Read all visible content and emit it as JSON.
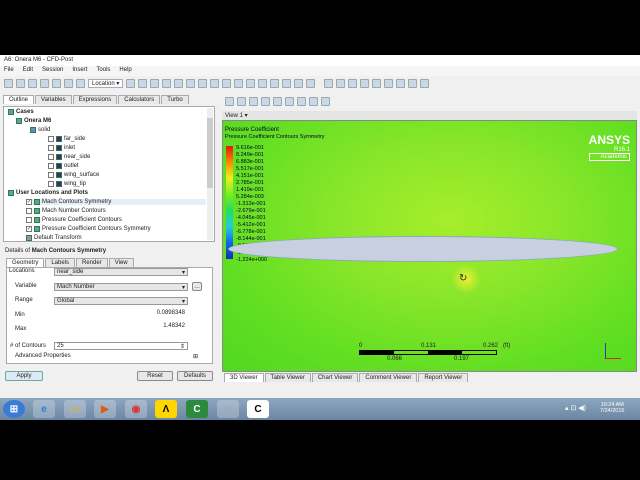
{
  "window": {
    "title": "A6: Onera M6 - CFD-Post"
  },
  "menu": [
    "File",
    "Edit",
    "Session",
    "Insert",
    "Tools",
    "Help"
  ],
  "toolbar": {
    "location_label": "Location"
  },
  "left_tabs": [
    "Outline",
    "Variables",
    "Expressions",
    "Calculators",
    "Turbo"
  ],
  "tree": {
    "cases": "Cases",
    "case": "Onera M6",
    "domain": "solid",
    "boundaries": [
      "far_side",
      "inlet",
      "near_side",
      "outlet",
      "wing_surface",
      "wing_tip"
    ],
    "user_locations": "User Locations and Plots",
    "plots": [
      {
        "label": "Mach Contours Symmetry",
        "checked": true
      },
      {
        "label": "Mach Number Contours",
        "checked": false
      },
      {
        "label": "Pressure Coefficient Contours",
        "checked": false
      },
      {
        "label": "Pressure Coefficient Contours Symmetry",
        "checked": true
      }
    ],
    "default_transform": "Default Transform"
  },
  "details": {
    "prefix": "Details of",
    "object": "Mach Contours Symmetry",
    "tabs": [
      "Geometry",
      "Labels",
      "Render",
      "View"
    ],
    "locations_label": "Locations",
    "locations_value": "near_side",
    "variable_label": "Variable",
    "variable_value": "Mach Number",
    "range_label": "Range",
    "range_value": "Global",
    "min_label": "Min",
    "min_value": "0.0898348",
    "max_label": "Max",
    "max_value": "1.48342",
    "contours_label": "# of Contours",
    "contours_value": "25",
    "advanced": "Advanced Properties",
    "apply": "Apply",
    "reset": "Reset",
    "defaults": "Defaults"
  },
  "viewer": {
    "view_label": "View 1",
    "legend_title": "Pressure Coefficient",
    "legend_subtitle": "Pressure Coefficient Contours Symmetry",
    "legend_values": [
      "9.616e-001",
      "8.249e-001",
      "6.883e-001",
      "5.517e-001",
      "4.151e-001",
      "2.785e-001",
      "1.419e-001",
      "5.284e-003",
      "-1.313e-001",
      "-2.679e-001",
      "-4.045e-001",
      "-5.412e-001",
      "-6.778e-001",
      "-8.144e-001",
      "-9.510e-001",
      "-1.088e+000",
      "-1.224e+000"
    ],
    "brand": "ANSYS",
    "version": "R16.1",
    "edition": "Academic",
    "scale_top": [
      "0",
      "0.131",
      "0.262",
      "(ft)"
    ],
    "scale_bottom": [
      "0.066",
      "0.197"
    ]
  },
  "viewer_tabs": [
    "3D Viewer",
    "Table Viewer",
    "Chart Viewer",
    "Comment Viewer",
    "Report Viewer"
  ],
  "taskbar": {
    "time": "10:24 AM",
    "date": "7/24/2015"
  }
}
